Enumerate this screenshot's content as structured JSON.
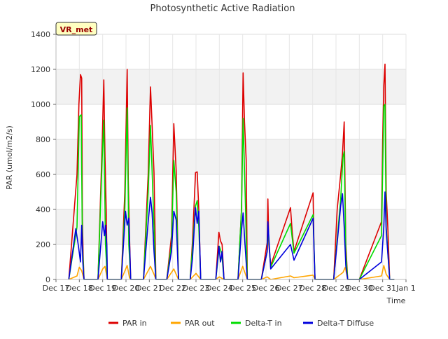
{
  "chart_data": {
    "type": "line",
    "title": "Photosynthetic Active Radiation",
    "xlabel": "Time",
    "ylabel": "PAR (umol/m2/s)",
    "annotation": "VR_met",
    "ylim": [
      0,
      1400
    ],
    "xlim": [
      0,
      15
    ],
    "yticks": [
      0,
      200,
      400,
      600,
      800,
      1000,
      1200,
      1400
    ],
    "xticks": [
      {
        "x": 0,
        "label": "Dec 17"
      },
      {
        "x": 1,
        "label": "Dec 18"
      },
      {
        "x": 2,
        "label": "Dec 19"
      },
      {
        "x": 3,
        "label": "Dec 20"
      },
      {
        "x": 4,
        "label": "Dec 21"
      },
      {
        "x": 5,
        "label": "Dec 22"
      },
      {
        "x": 6,
        "label": "Dec 23"
      },
      {
        "x": 7,
        "label": "Dec 24"
      },
      {
        "x": 8,
        "label": "Dec 25"
      },
      {
        "x": 9,
        "label": "Dec 26"
      },
      {
        "x": 10,
        "label": "Dec 27"
      },
      {
        "x": 11,
        "label": "Dec 28"
      },
      {
        "x": 12,
        "label": "Dec 29"
      },
      {
        "x": 13,
        "label": "Dec 30"
      },
      {
        "x": 14,
        "label": "Dec 31"
      },
      {
        "x": 15,
        "label": "Jan 1"
      }
    ],
    "grid": true,
    "legend_position": "bottom",
    "series": [
      {
        "name": "PAR in",
        "color": "#dd0000",
        "points": [
          [
            0.55,
            0
          ],
          [
            0.9,
            600
          ],
          [
            0.98,
            1000
          ],
          [
            1.05,
            1170
          ],
          [
            1.1,
            1150
          ],
          [
            1.13,
            350
          ],
          [
            1.16,
            150
          ],
          [
            1.2,
            0
          ],
          [
            1.8,
            0
          ],
          [
            1.98,
            780
          ],
          [
            2.05,
            1140
          ],
          [
            2.1,
            700
          ],
          [
            2.15,
            400
          ],
          [
            2.2,
            0
          ],
          [
            2.8,
            0
          ],
          [
            2.95,
            500
          ],
          [
            3.05,
            1200
          ],
          [
            3.1,
            560
          ],
          [
            3.15,
            250
          ],
          [
            3.2,
            0
          ],
          [
            3.75,
            0
          ],
          [
            3.95,
            600
          ],
          [
            4.05,
            1100
          ],
          [
            4.12,
            880
          ],
          [
            4.2,
            610
          ],
          [
            4.28,
            0
          ],
          [
            4.75,
            0
          ],
          [
            4.95,
            250
          ],
          [
            5.05,
            890
          ],
          [
            5.15,
            620
          ],
          [
            5.25,
            0
          ],
          [
            5.75,
            0
          ],
          [
            5.85,
            220
          ],
          [
            5.98,
            610
          ],
          [
            6.05,
            615
          ],
          [
            6.12,
            400
          ],
          [
            6.2,
            0
          ],
          [
            6.85,
            0
          ],
          [
            6.98,
            270
          ],
          [
            7.05,
            220
          ],
          [
            7.12,
            200
          ],
          [
            7.2,
            0
          ],
          [
            7.8,
            0
          ],
          [
            7.95,
            400
          ],
          [
            8.02,
            1180
          ],
          [
            8.08,
            900
          ],
          [
            8.15,
            680
          ],
          [
            8.2,
            0
          ],
          [
            8.8,
            0
          ],
          [
            9.05,
            210
          ],
          [
            9.08,
            460
          ],
          [
            9.12,
            200
          ],
          [
            9.2,
            80
          ],
          [
            10.05,
            410
          ],
          [
            10.12,
            280
          ],
          [
            10.2,
            160
          ],
          [
            11.02,
            495
          ],
          [
            11.06,
            150
          ],
          [
            11.1,
            0
          ],
          [
            11.9,
            0
          ],
          [
            12.05,
            400
          ],
          [
            12.2,
            600
          ],
          [
            12.28,
            720
          ],
          [
            12.35,
            900
          ],
          [
            12.42,
            200
          ],
          [
            12.5,
            0
          ],
          [
            13,
            0
          ],
          [
            13.95,
            330
          ],
          [
            14.0,
            800
          ],
          [
            14.05,
            1110
          ],
          [
            14.1,
            1230
          ],
          [
            14.15,
            500
          ],
          [
            14.22,
            300
          ],
          [
            14.3,
            0
          ],
          [
            14.5,
            0
          ]
        ]
      },
      {
        "name": "PAR out",
        "color": "#ffa500",
        "points": [
          [
            0.55,
            0
          ],
          [
            0.9,
            20
          ],
          [
            1.0,
            70
          ],
          [
            1.1,
            50
          ],
          [
            1.2,
            0
          ],
          [
            1.8,
            0
          ],
          [
            2.0,
            60
          ],
          [
            2.1,
            75
          ],
          [
            2.2,
            0
          ],
          [
            2.8,
            0
          ],
          [
            3.05,
            80
          ],
          [
            3.15,
            10
          ],
          [
            3.2,
            0
          ],
          [
            3.75,
            0
          ],
          [
            4.05,
            75
          ],
          [
            4.2,
            30
          ],
          [
            4.28,
            0
          ],
          [
            4.75,
            0
          ],
          [
            5.05,
            60
          ],
          [
            5.25,
            0
          ],
          [
            5.75,
            0
          ],
          [
            6.0,
            35
          ],
          [
            6.2,
            0
          ],
          [
            6.85,
            0
          ],
          [
            7.0,
            15
          ],
          [
            7.2,
            0
          ],
          [
            7.8,
            0
          ],
          [
            8.0,
            75
          ],
          [
            8.2,
            0
          ],
          [
            8.8,
            0
          ],
          [
            9.05,
            15
          ],
          [
            9.2,
            0
          ],
          [
            10.05,
            20
          ],
          [
            10.2,
            10
          ],
          [
            11.02,
            25
          ],
          [
            11.1,
            0
          ],
          [
            11.9,
            0
          ],
          [
            12.3,
            40
          ],
          [
            12.4,
            70
          ],
          [
            12.5,
            0
          ],
          [
            13,
            0
          ],
          [
            13.95,
            20
          ],
          [
            14.05,
            80
          ],
          [
            14.15,
            30
          ],
          [
            14.3,
            0
          ],
          [
            14.5,
            0
          ]
        ]
      },
      {
        "name": "Delta-T in",
        "color": "#00dd00",
        "points": [
          [
            0.55,
            0
          ],
          [
            0.9,
            300
          ],
          [
            1.0,
            930
          ],
          [
            1.08,
            940
          ],
          [
            1.13,
            200
          ],
          [
            1.2,
            0
          ],
          [
            1.8,
            0
          ],
          [
            1.98,
            690
          ],
          [
            2.05,
            910
          ],
          [
            2.12,
            200
          ],
          [
            2.2,
            0
          ],
          [
            2.8,
            0
          ],
          [
            2.95,
            400
          ],
          [
            3.05,
            980
          ],
          [
            3.12,
            200
          ],
          [
            3.2,
            0
          ],
          [
            3.75,
            0
          ],
          [
            3.95,
            500
          ],
          [
            4.05,
            880
          ],
          [
            4.12,
            620
          ],
          [
            4.2,
            300
          ],
          [
            4.28,
            0
          ],
          [
            4.75,
            0
          ],
          [
            4.95,
            200
          ],
          [
            5.05,
            680
          ],
          [
            5.15,
            500
          ],
          [
            5.25,
            0
          ],
          [
            5.75,
            0
          ],
          [
            5.98,
            420
          ],
          [
            6.05,
            450
          ],
          [
            6.12,
            300
          ],
          [
            6.2,
            0
          ],
          [
            6.85,
            0
          ],
          [
            7.0,
            190
          ],
          [
            7.1,
            150
          ],
          [
            7.2,
            0
          ],
          [
            7.8,
            0
          ],
          [
            7.95,
            400
          ],
          [
            8.02,
            920
          ],
          [
            8.1,
            520
          ],
          [
            8.2,
            0
          ],
          [
            8.8,
            0
          ],
          [
            9.05,
            160
          ],
          [
            9.08,
            300
          ],
          [
            9.2,
            70
          ],
          [
            10.05,
            320
          ],
          [
            10.2,
            150
          ],
          [
            11.02,
            370
          ],
          [
            11.1,
            0
          ],
          [
            11.9,
            0
          ],
          [
            12.2,
            460
          ],
          [
            12.3,
            700
          ],
          [
            12.35,
            730
          ],
          [
            12.42,
            150
          ],
          [
            12.5,
            0
          ],
          [
            13,
            0
          ],
          [
            13.95,
            250
          ],
          [
            14.05,
            990
          ],
          [
            14.1,
            1000
          ],
          [
            14.15,
            300
          ],
          [
            14.3,
            0
          ],
          [
            14.5,
            0
          ]
        ]
      },
      {
        "name": "Delta-T Diffuse",
        "color": "#0000dd",
        "points": [
          [
            0.55,
            0
          ],
          [
            0.85,
            290
          ],
          [
            0.95,
            200
          ],
          [
            1.05,
            100
          ],
          [
            1.1,
            310
          ],
          [
            1.15,
            100
          ],
          [
            1.2,
            0
          ],
          [
            1.8,
            0
          ],
          [
            2.0,
            330
          ],
          [
            2.08,
            250
          ],
          [
            2.12,
            310
          ],
          [
            2.18,
            190
          ],
          [
            2.2,
            0
          ],
          [
            2.8,
            0
          ],
          [
            2.98,
            390
          ],
          [
            3.05,
            310
          ],
          [
            3.12,
            350
          ],
          [
            3.2,
            0
          ],
          [
            3.75,
            0
          ],
          [
            3.95,
            330
          ],
          [
            4.05,
            470
          ],
          [
            4.12,
            380
          ],
          [
            4.2,
            160
          ],
          [
            4.28,
            0
          ],
          [
            4.75,
            0
          ],
          [
            4.95,
            160
          ],
          [
            5.05,
            390
          ],
          [
            5.15,
            340
          ],
          [
            5.25,
            0
          ],
          [
            5.75,
            0
          ],
          [
            5.85,
            120
          ],
          [
            5.98,
            410
          ],
          [
            6.05,
            320
          ],
          [
            6.12,
            390
          ],
          [
            6.2,
            0
          ],
          [
            6.85,
            0
          ],
          [
            6.98,
            190
          ],
          [
            7.05,
            100
          ],
          [
            7.12,
            160
          ],
          [
            7.2,
            0
          ],
          [
            7.8,
            0
          ],
          [
            7.95,
            280
          ],
          [
            8.02,
            380
          ],
          [
            8.1,
            200
          ],
          [
            8.2,
            0
          ],
          [
            8.8,
            0
          ],
          [
            9.05,
            160
          ],
          [
            9.08,
            330
          ],
          [
            9.2,
            60
          ],
          [
            10.05,
            200
          ],
          [
            10.2,
            110
          ],
          [
            11.02,
            350
          ],
          [
            11.1,
            0
          ],
          [
            11.9,
            0
          ],
          [
            12.2,
            420
          ],
          [
            12.28,
            490
          ],
          [
            12.35,
            300
          ],
          [
            12.42,
            80
          ],
          [
            12.5,
            0
          ],
          [
            13,
            0
          ],
          [
            13.95,
            100
          ],
          [
            14.05,
            300
          ],
          [
            14.1,
            500
          ],
          [
            14.15,
            280
          ],
          [
            14.3,
            0
          ],
          [
            14.5,
            0
          ]
        ]
      }
    ]
  }
}
